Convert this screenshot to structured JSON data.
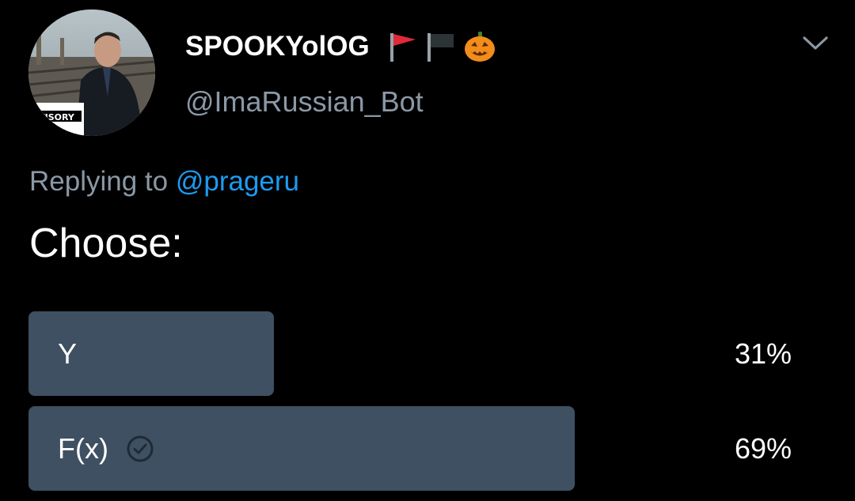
{
  "author": {
    "display_name": "SPOOKYolOG",
    "handle": "@ImaRussian_Bot",
    "name_emojis": [
      "red-flag-icon",
      "black-flag-icon",
      "jack-o-lantern-icon"
    ]
  },
  "reply": {
    "prefix": "Replying to",
    "mention": "@prageru"
  },
  "tweet": {
    "text": "Choose:"
  },
  "poll": {
    "options": [
      {
        "label": "Y",
        "percent_text": "31%",
        "fraction": 0.31,
        "selected": false
      },
      {
        "label": "F(x)",
        "percent_text": "69%",
        "fraction": 0.69,
        "selected": true
      }
    ]
  },
  "colors": {
    "background": "#000000",
    "name": "#ffffff",
    "secondary_text": "#8b98a5",
    "mention": "#1d9bf0",
    "poll_bar": "#3e5061"
  }
}
